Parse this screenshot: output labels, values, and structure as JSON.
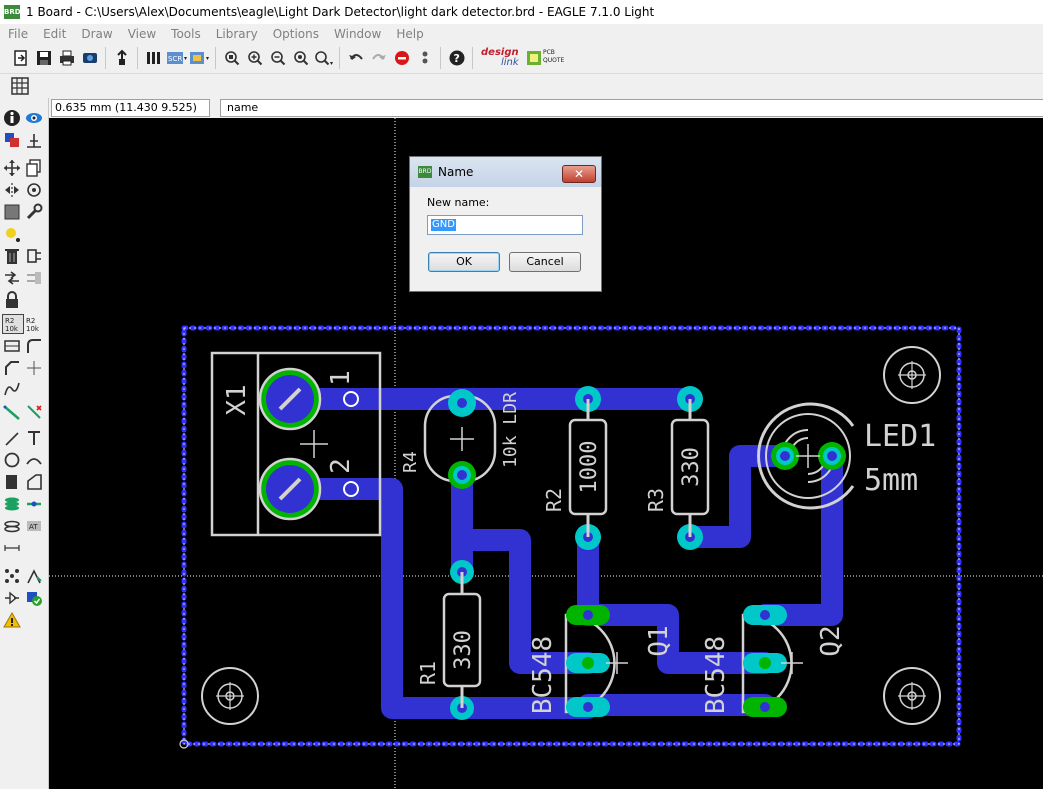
{
  "window": {
    "app_icon_text": "BRD",
    "title": "1 Board - C:\\Users\\Alex\\Documents\\eagle\\Light Dark Detector\\light dark detector.brd - EAGLE 7.1.0 Light"
  },
  "menu": [
    "File",
    "Edit",
    "Draw",
    "View",
    "Tools",
    "Library",
    "Options",
    "Window",
    "Help"
  ],
  "toolbar": {
    "designlink_line1": "design",
    "designlink_line2": "link",
    "pcb_quote_line1": "PCB",
    "pcb_quote_line2": "QUOTE",
    "scr_label": "SCR"
  },
  "command_bar": {
    "coordinates": "0.635 mm (11.430 9.525)",
    "command": "name"
  },
  "left_tools": {
    "r2_label": "R2",
    "r2_value": "10k"
  },
  "dialog": {
    "app_icon_text": "BRD",
    "title": "Name",
    "close_symbol": "✕",
    "label": "New name:",
    "value": "GND",
    "ok_label": "OK",
    "cancel_label": "Cancel"
  },
  "board": {
    "labels": {
      "x1": "X1",
      "x1_pin1": "1",
      "x1_pin2": "2",
      "r4_name": "R4",
      "r4_value": "10k LDR",
      "r2_name": "R2",
      "r2_value": "1000",
      "r3_name": "R3",
      "r3_value": "330",
      "r1_name": "R1",
      "r1_value": "330",
      "led_name": "LED1",
      "led_value": "5mm",
      "q1_value": "BC548",
      "q1_name": "Q1",
      "q2_value": "BC548",
      "q2_name": "Q2"
    },
    "colors": {
      "canvas": "#000000",
      "trace": "#3232d2",
      "pad": "#00c8c8",
      "pad_hole": "#00a0a0",
      "silkscreen": "#d2d2d2",
      "outline": "#3232ff",
      "green_pad": "#00b400",
      "crosshair": "#ffffff"
    }
  }
}
